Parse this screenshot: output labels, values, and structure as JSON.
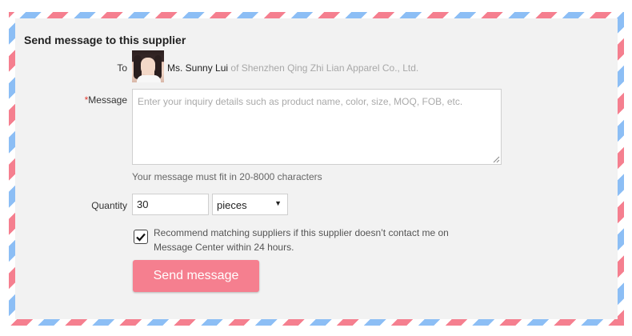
{
  "form": {
    "title": "Send message to this supplier",
    "to_label": "To",
    "supplier_name": "Ms. Sunny Lui",
    "supplier_company": "of Shenzhen Qing Zhi Lian Apparel Co., Ltd.",
    "required_mark": "*",
    "message_label": "Message",
    "message_placeholder": "Enter your inquiry details such as product name, color, size, MOQ, FOB, etc.",
    "message_value": "",
    "message_hint": "Your message must fit in 20-8000 characters",
    "quantity_label": "Quantity",
    "quantity_value": "30",
    "unit_selected": "pieces",
    "recommend_checked": true,
    "recommend_text": "Recommend matching suppliers if this supplier doesn’t contact me on Message Center within 24 hours.",
    "send_label": "Send message"
  },
  "colors": {
    "accent_pink": "#f57f8f",
    "stripe_blue": "#8cbef5",
    "panel_bg": "#f2f2f2"
  },
  "icons": {
    "avatar": "supplier-avatar-photo",
    "select_caret": "caret-down-icon",
    "checkmark": "checkmark-icon",
    "resize_grip": "resize-grip-icon"
  }
}
